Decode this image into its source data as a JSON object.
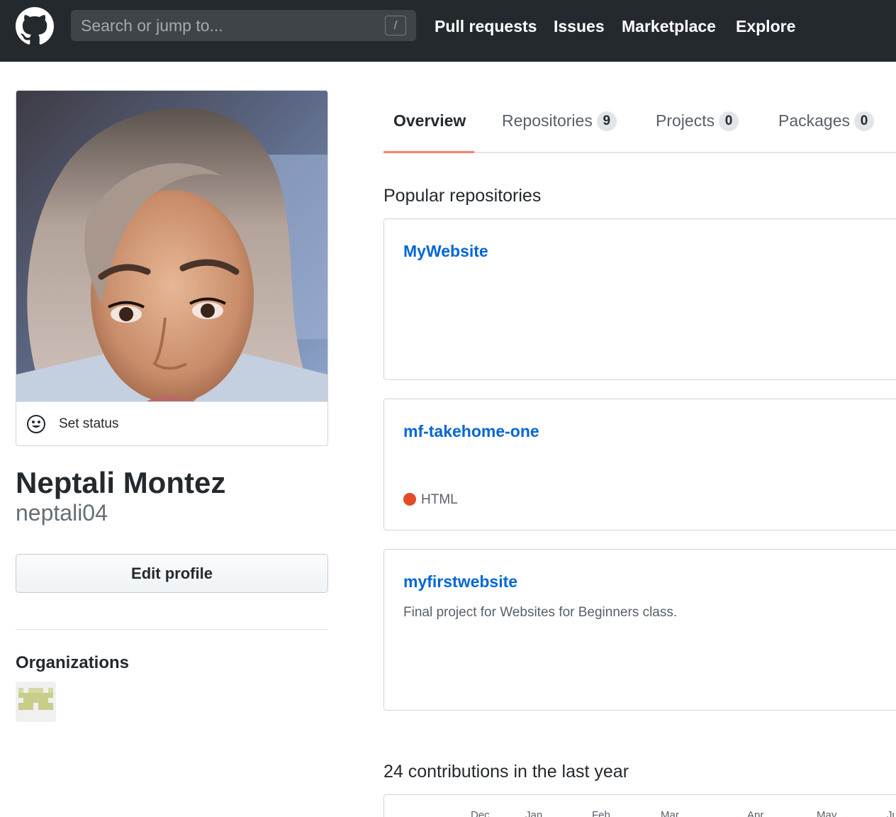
{
  "header": {
    "search_placeholder": "Search or jump to...",
    "search_shortcut": "/",
    "nav": [
      "Pull requests",
      "Issues",
      "Marketplace",
      "Explore"
    ],
    "background": "#24292e"
  },
  "profile": {
    "set_status_label": "Set status",
    "full_name": "Neptali Montez",
    "username": "neptali04",
    "edit_profile_label": "Edit profile",
    "organizations_heading": "Organizations"
  },
  "tabs": [
    {
      "label": "Overview",
      "count": null,
      "selected": true
    },
    {
      "label": "Repositories",
      "count": "9",
      "selected": false
    },
    {
      "label": "Projects",
      "count": "0",
      "selected": false
    },
    {
      "label": "Packages",
      "count": "0",
      "selected": false
    }
  ],
  "popular": {
    "title": "Popular repositories",
    "repos": [
      {
        "name": "MyWebsite",
        "description": "",
        "language": ""
      },
      {
        "name": "mf-takehome-one",
        "description": "",
        "language": "HTML",
        "language_color": "#e34c26"
      },
      {
        "name": "myfirstwebsite",
        "description": "Final project for Websites for Beginners class.",
        "language": ""
      }
    ]
  },
  "contributions": {
    "title": "24 contributions in the last year",
    "months": [
      "Dec",
      "Jan",
      "Feb",
      "Mar",
      "Apr",
      "May",
      "Ju"
    ]
  },
  "colors": {
    "link": "#0366d6",
    "selected_tab_underline": "#f9826c",
    "html_language": "#e34c26"
  }
}
